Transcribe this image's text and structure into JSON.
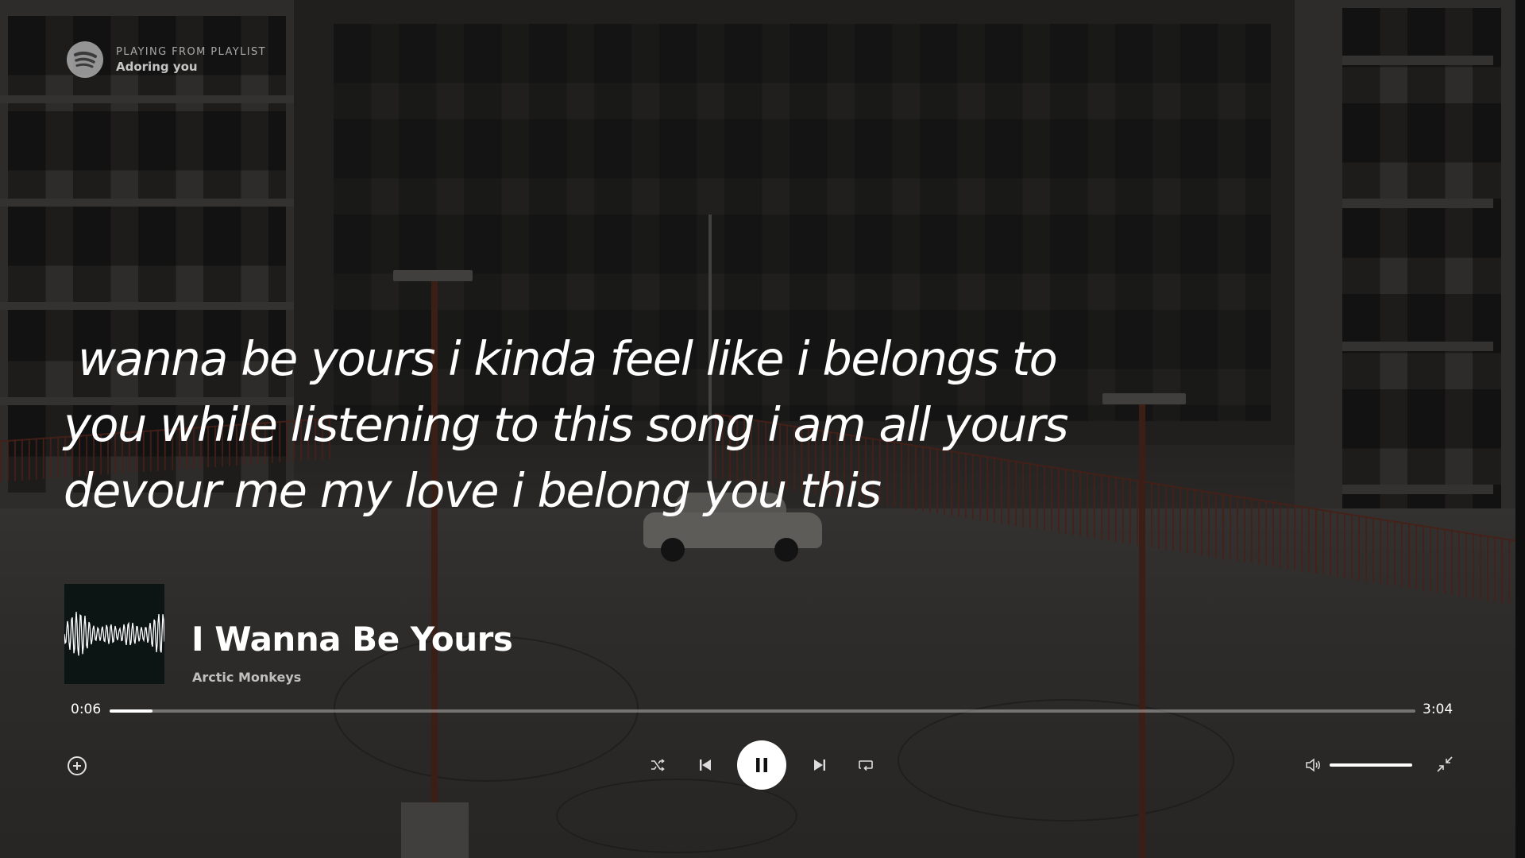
{
  "context": {
    "label": "PLAYING FROM PLAYLIST",
    "playlist_name": "Adoring you",
    "logo_icon": "spotify-logo-icon"
  },
  "lyrics": {
    "lines": [
      "wanna be yours i kinda feel like i belongs to",
      "you while listening to this song i am all yours",
      "devour me my love i belong you this"
    ]
  },
  "track": {
    "title": "I Wanna Be Yours",
    "artist": "Arctic Monkeys",
    "cover_icon": "soundwave-album-art"
  },
  "playback": {
    "elapsed": "0:06",
    "total": "3:04",
    "progress_fraction": 0.0326
  },
  "controls": {
    "add": "add-circle-icon",
    "shuffle": "shuffle-icon",
    "previous": "skip-previous-icon",
    "play_pause": "pause-icon",
    "next": "skip-next-icon",
    "repeat": "repeat-icon",
    "volume": "volume-icon",
    "exit_fullscreen": "minimize-icon"
  },
  "volume": {
    "level_fraction": 1.0
  },
  "colors": {
    "text": "#ffffff",
    "muted_text": "rgba(255,255,255,0.7)",
    "progress_bg": "rgba(255,255,255,0.35)"
  }
}
